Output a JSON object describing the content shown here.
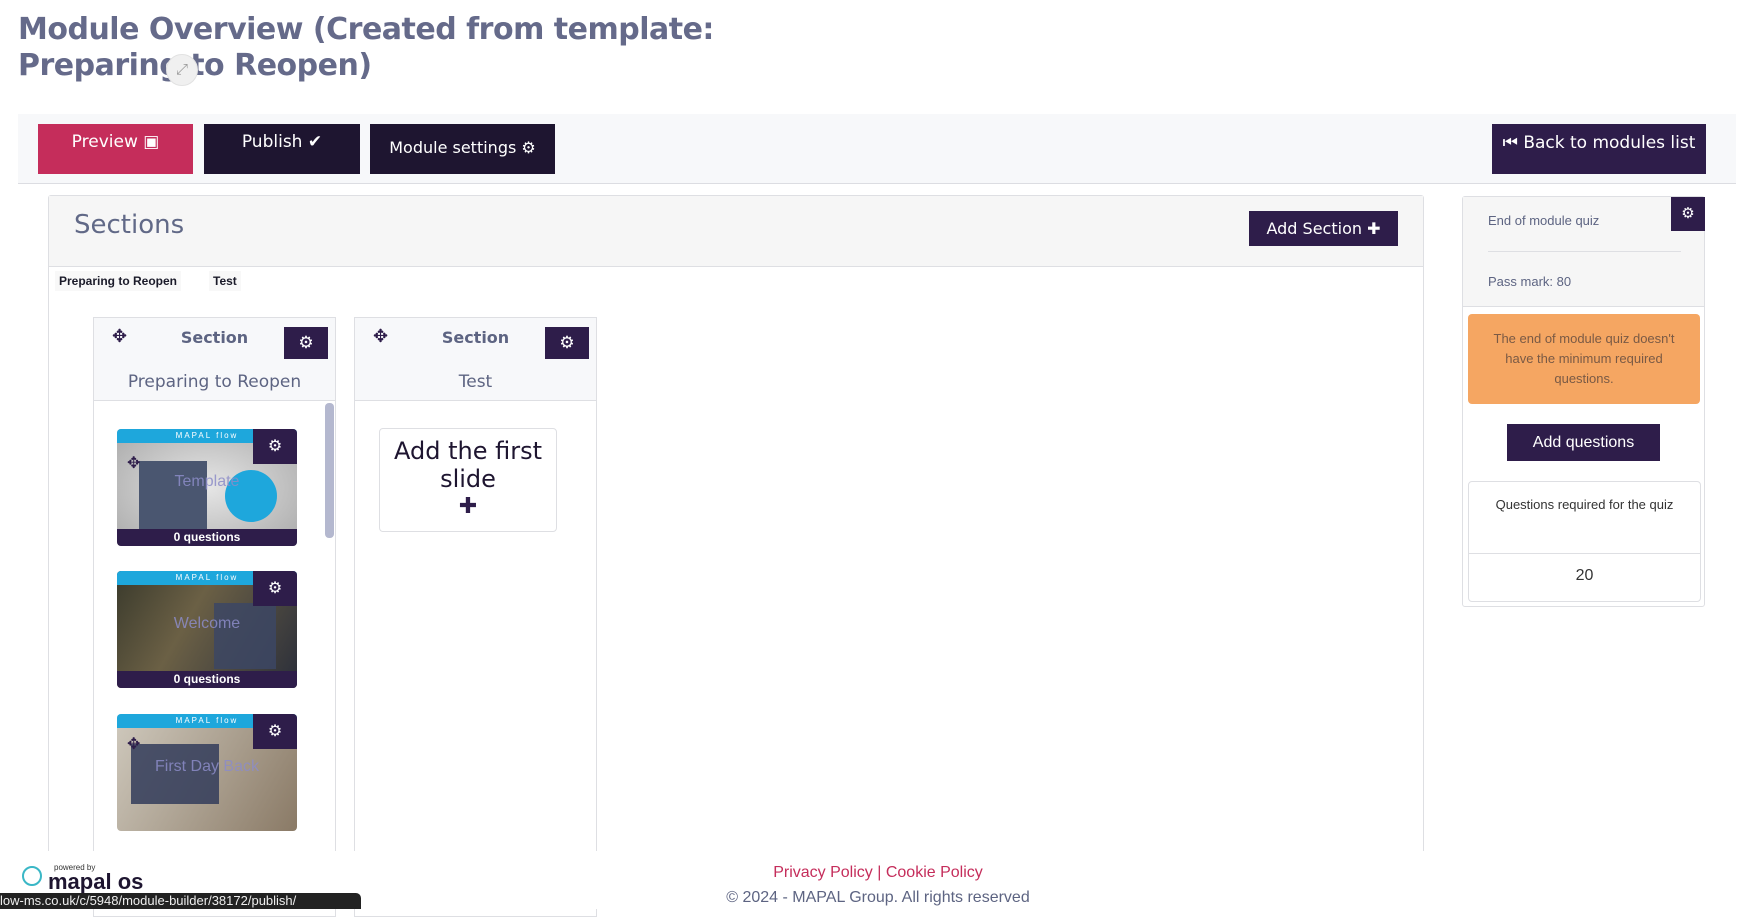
{
  "header": {
    "title": "Module Overview (Created from template: Preparing to Reopen)",
    "expand_icon": "expand-arrows-icon"
  },
  "toolbar": {
    "preview": "Preview",
    "publish": "Publish",
    "module_settings": "Module settings",
    "back": "Back to modules list"
  },
  "sections": {
    "title": "Sections",
    "add_section": "Add Section",
    "tabs": [
      "Preparing to Reopen",
      "Test"
    ],
    "columns": [
      {
        "label": "Section",
        "name": "Preparing to Reopen",
        "slides": [
          {
            "title": "Template",
            "questions": "0 questions",
            "brand": "MAPAL flow"
          },
          {
            "title": "Welcome",
            "questions": "0 questions",
            "brand": "MAPAL flow"
          },
          {
            "title": "First Day Back",
            "brand": "MAPAL flow"
          }
        ]
      },
      {
        "label": "Section",
        "name": "Test",
        "add_slide": "Add the first slide"
      }
    ]
  },
  "quiz": {
    "title": "End of module quiz",
    "pass_mark": "Pass mark: 80",
    "warning": "The end of module quiz doesn't have the minimum required questions.",
    "add_questions": "Add questions",
    "required_label": "Questions required for the quiz",
    "required_value": "20"
  },
  "footer": {
    "privacy": "Privacy Policy",
    "separator": "|",
    "cookie": "Cookie Policy",
    "copyright": "© 2024 - MAPAL Group. All rights reserved",
    "powered_by": "powered by",
    "logo": "mapal os",
    "status_url": "low-ms.co.uk/c/5948/module-builder/38172/publish/"
  },
  "colors": {
    "accent": "#c52d5b",
    "primary": "#2e1d4a",
    "warning": "#f5a662"
  }
}
